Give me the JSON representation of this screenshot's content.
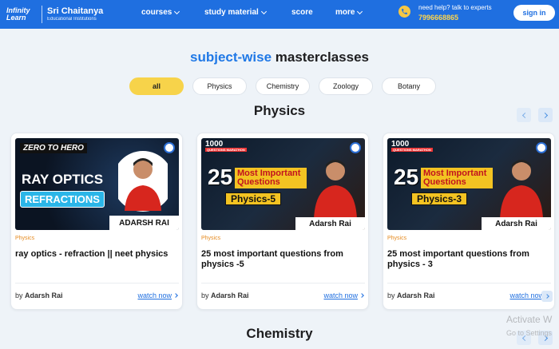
{
  "header": {
    "logo_infinity": "Infinity Learn",
    "logo_brand": "Sri Chaitanya",
    "logo_sub": "Educational Institutions",
    "nav": [
      "courses",
      "study material",
      "score",
      "more"
    ],
    "help_text": "need help? talk to experts",
    "phone": "7996668865",
    "signin": "sign in",
    "colors": {
      "bg": "#1f6fe0",
      "accent": "#f6c744"
    }
  },
  "page": {
    "title_blue": "subject-wise",
    "title_rest": "masterclasses",
    "filters": [
      {
        "label": "all",
        "active": true
      },
      {
        "label": "Physics",
        "active": false
      },
      {
        "label": "Chemistry",
        "active": false
      },
      {
        "label": "Zoology",
        "active": false
      },
      {
        "label": "Botany",
        "active": false
      }
    ]
  },
  "physics": {
    "heading": "Physics",
    "cards": [
      {
        "subject": "Physics",
        "title": "ray optics - refraction || neet physics",
        "by_prefix": "by",
        "author": "Adarsh Rai",
        "cta": "watch now",
        "thumb": {
          "tag": "ZERO TO HERO",
          "line1": "RAY OPTICS",
          "line2": "REFRACTIONS",
          "name": "ADARSH RAI"
        }
      },
      {
        "subject": "Physics",
        "title": "25 most important questions from physics -5",
        "by_prefix": "by",
        "author": "Adarsh Rai",
        "cta": "watch now",
        "thumb": {
          "badge": "1000",
          "badge_sub": "QUESTIONS MARATHON",
          "num": "25",
          "line1": "Most Important Questions",
          "line2": "Physics-5",
          "name": "Adarsh Rai"
        }
      },
      {
        "subject": "Physics",
        "title": "25 most important questions from physics - 3",
        "by_prefix": "by",
        "author": "Adarsh Rai",
        "cta": "watch now",
        "thumb": {
          "badge": "1000",
          "badge_sub": "QUESTIONS MARATHON",
          "num": "25",
          "line1": "Most Important Questions",
          "line2": "Physics-3",
          "name": "Adarsh Rai"
        }
      }
    ]
  },
  "chemistry": {
    "heading": "Chemistry"
  },
  "watermark": {
    "line1": "Activate W",
    "line2": "Go to Settings"
  }
}
